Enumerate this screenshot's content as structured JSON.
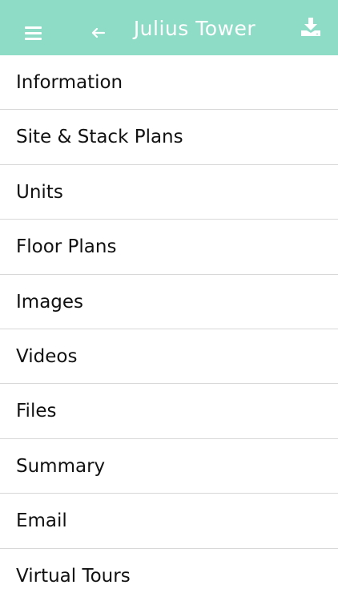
{
  "header": {
    "title": "Julius Tower",
    "background_color": "#8edcc6",
    "icons": [
      "hamburger-menu-icon",
      "arrow-left-icon",
      "download-icon"
    ]
  },
  "menu": {
    "items": [
      {
        "label": "Information"
      },
      {
        "label": "Site & Stack Plans"
      },
      {
        "label": "Units"
      },
      {
        "label": "Floor Plans"
      },
      {
        "label": "Images"
      },
      {
        "label": "Videos"
      },
      {
        "label": "Files"
      },
      {
        "label": "Summary"
      },
      {
        "label": "Email"
      },
      {
        "label": "Virtual Tours"
      }
    ]
  }
}
